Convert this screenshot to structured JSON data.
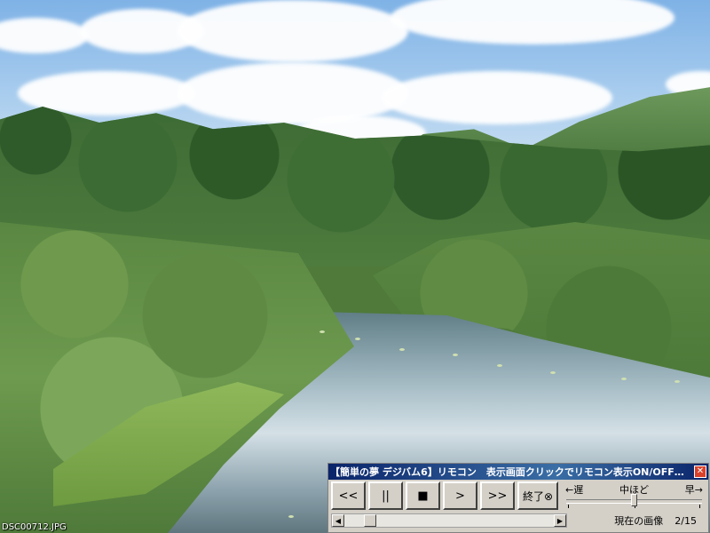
{
  "photo": {
    "filename": "DSC00712.JPG"
  },
  "remote": {
    "title": "【簡単の夢 デジバム6】リモコン　表示画面クリックでリモコン表示ON/OFF…",
    "close_label": "✕",
    "buttons": {
      "first": "<<",
      "pause": "||",
      "stop": "■",
      "next": ">",
      "last": ">>",
      "exit": "終了⊗"
    },
    "speed": {
      "slow_label": "←遅",
      "mid_label": "中ほど",
      "fast_label": "早→",
      "level": 0.5
    },
    "scroll_left": "◀",
    "scroll_right": "▶",
    "position": 0.1,
    "current_label": "現在の画像",
    "current_value": "2/15"
  }
}
